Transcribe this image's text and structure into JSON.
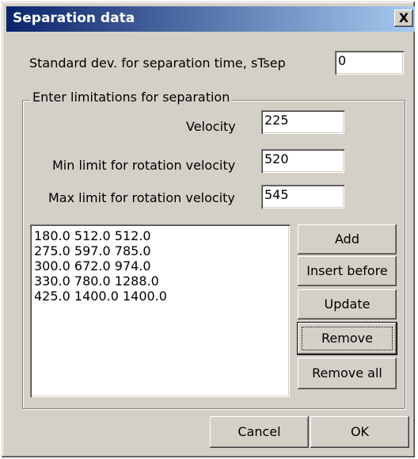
{
  "window": {
    "title": "Separation data",
    "close_glyph": "X"
  },
  "std_dev": {
    "label": "Standard dev. for separation time, sTsep",
    "value": "0"
  },
  "group": {
    "legend": "Enter limitations for separation",
    "velocity": {
      "label": "Velocity",
      "value": "225"
    },
    "min_rot": {
      "label": "Min limit for rotation velocity",
      "value": "520"
    },
    "max_rot": {
      "label": "Max limit for rotation velocity",
      "value": "545"
    },
    "list": [
      "180.0 512.0 512.0",
      "275.0 597.0 785.0",
      "300.0 672.0 974.0",
      "330.0 780.0 1288.0",
      "425.0 1400.0 1400.0"
    ],
    "buttons": {
      "add": "Add",
      "insert_before": "Insert before",
      "update": "Update",
      "remove": "Remove",
      "remove_all": "Remove all"
    }
  },
  "footer": {
    "cancel": "Cancel",
    "ok": "OK"
  }
}
